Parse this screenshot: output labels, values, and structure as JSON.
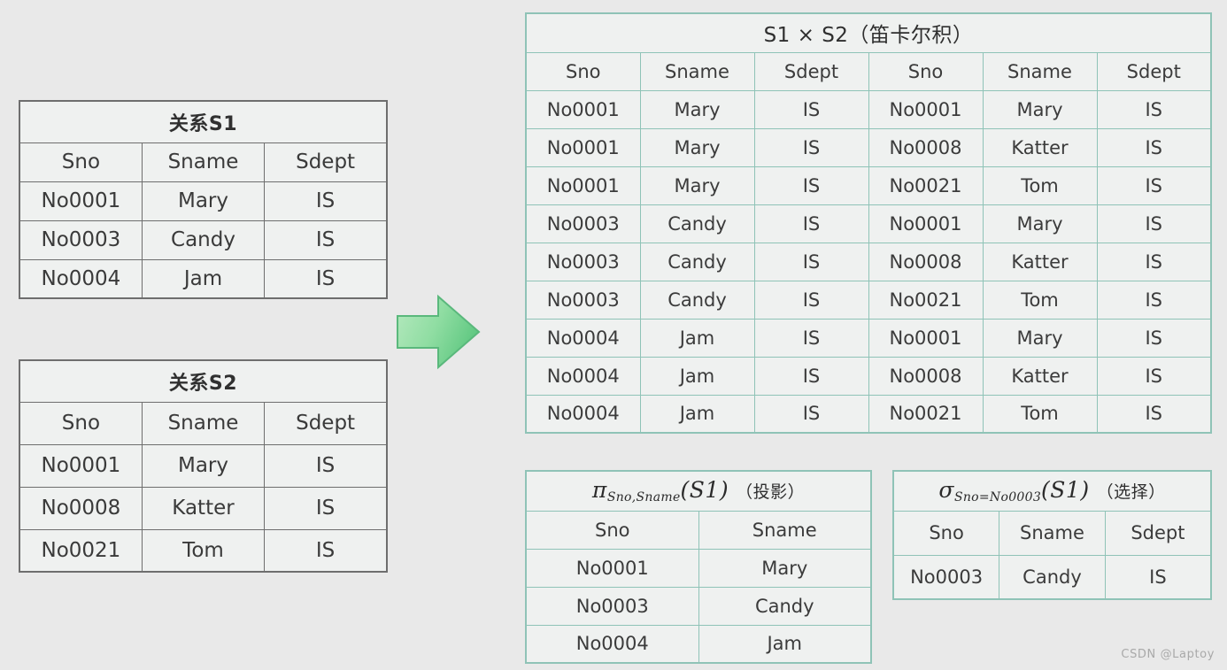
{
  "background_color": "#e9e9e9",
  "colors": {
    "grey_border": "#6e6e6e",
    "teal_border": "#8fc3b7",
    "highlight_red": "#f01818",
    "highlight_blue": "#2c2c86",
    "arrow_green": "#8fe0a0"
  },
  "relation_s1": {
    "title": "关系S1",
    "columns": [
      "Sno",
      "Sname",
      "Sdept"
    ],
    "rows": [
      [
        "No0001",
        "Mary",
        "IS"
      ],
      [
        "No0003",
        "Candy",
        "IS"
      ],
      [
        "No0004",
        "Jam",
        "IS"
      ]
    ]
  },
  "relation_s2": {
    "title": "关系S2",
    "columns": [
      "Sno",
      "Sname",
      "Sdept"
    ],
    "rows": [
      [
        "No0001",
        "Mary",
        "IS"
      ],
      [
        "No0008",
        "Katter",
        "IS"
      ],
      [
        "No0021",
        "Tom",
        "IS"
      ]
    ]
  },
  "arrow": {
    "icon": "arrow-right-icon"
  },
  "cartesian_product": {
    "title": "S1 × S2（笛卡尔积）",
    "columns": [
      "Sno",
      "Sname",
      "Sdept",
      "Sno",
      "Sname",
      "Sdept"
    ],
    "rows": [
      {
        "cells": [
          "No0001",
          "Mary",
          "IS",
          "No0001",
          "Mary",
          "IS"
        ],
        "right_color": "red"
      },
      {
        "cells": [
          "No0001",
          "Mary",
          "IS",
          "No0008",
          "Katter",
          "IS"
        ],
        "right_color": "red"
      },
      {
        "cells": [
          "No0001",
          "Mary",
          "IS",
          "No0021",
          "Tom",
          "IS"
        ],
        "right_color": "red"
      },
      {
        "cells": [
          "No0003",
          "Candy",
          "IS",
          "No0001",
          "Mary",
          "IS"
        ],
        "right_color": "none"
      },
      {
        "cells": [
          "No0003",
          "Candy",
          "IS",
          "No0008",
          "Katter",
          "IS"
        ],
        "right_color": "none"
      },
      {
        "cells": [
          "No0003",
          "Candy",
          "IS",
          "No0021",
          "Tom",
          "IS"
        ],
        "right_color": "none"
      },
      {
        "cells": [
          "No0004",
          "Jam",
          "IS",
          "No0001",
          "Mary",
          "IS"
        ],
        "right_color": "blue"
      },
      {
        "cells": [
          "No0004",
          "Jam",
          "IS",
          "No0008",
          "Katter",
          "IS"
        ],
        "right_color": "blue"
      },
      {
        "cells": [
          "No0004",
          "Jam",
          "IS",
          "No0021",
          "Tom",
          "IS"
        ],
        "right_color": "blue"
      }
    ]
  },
  "projection": {
    "operator": "π",
    "subscript": "Sno,Sname",
    "argument": "(S1)",
    "annotation": "（投影）",
    "columns": [
      "Sno",
      "Sname"
    ],
    "rows": [
      [
        "No0001",
        "Mary"
      ],
      [
        "No0003",
        "Candy"
      ],
      [
        "No0004",
        "Jam"
      ]
    ]
  },
  "selection": {
    "operator": "σ",
    "subscript": "Sno=No0003",
    "argument": "(S1)",
    "annotation": "（选择）",
    "columns": [
      "Sno",
      "Sname",
      "Sdept"
    ],
    "rows": [
      [
        "No0003",
        "Candy",
        "IS"
      ]
    ]
  },
  "watermark": {
    "text": "CSDN @Laptoy"
  }
}
